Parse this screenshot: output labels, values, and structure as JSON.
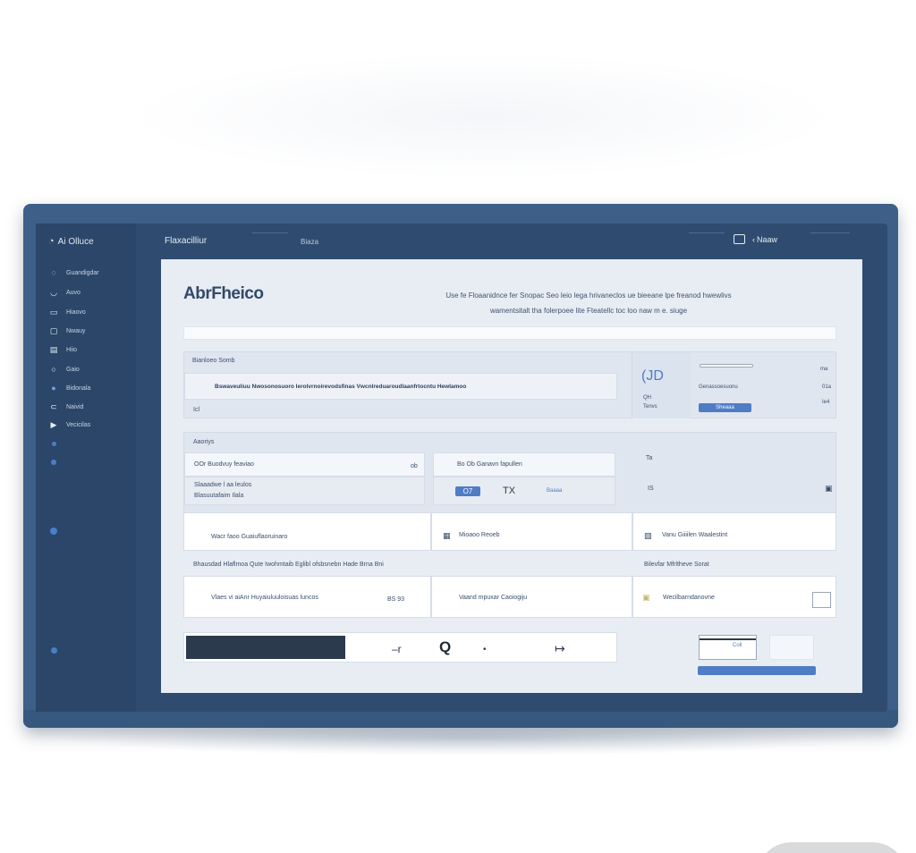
{
  "app": {
    "brand": "Ai Olluce",
    "header_title": "Flaxacilliur",
    "header_sub": "Biaza",
    "user_name": "Naaw"
  },
  "sidebar": {
    "items": [
      {
        "label": "Guandigdar",
        "icon": "swirl-icon"
      },
      {
        "label": "Auvo",
        "icon": "eye-icon"
      },
      {
        "label": "Hiaovo",
        "icon": "card-icon"
      },
      {
        "label": "Nwauy",
        "icon": "box-icon"
      },
      {
        "label": "Hiio",
        "icon": "chat-icon"
      },
      {
        "label": "Gaio",
        "icon": "circle-icon"
      },
      {
        "label": "Bidonala",
        "icon": "globe-icon"
      },
      {
        "label": "Naivid",
        "icon": "link-icon"
      },
      {
        "label": "Vecicilas",
        "icon": "play-icon"
      }
    ]
  },
  "main": {
    "title": "AbrFheico",
    "intro_line1": "Use fe Floaanidnce fer Snopac Seo leio lega hrivaneclos ue bieeane lpe freanod hwewlivs",
    "intro_line2": "wamentsitalt tha folerpoee lite Fteatellc toc loo naw m e. siuge",
    "panel1": {
      "label": "Bianloeo Somb",
      "input_text": "Bswaveuliuu Nwosonosuoro lerolvrnoirevodsfinas Vwcnlreduaroudlaanfrtocntu Hewlamoo",
      "footer": "Icl",
      "right": {
        "big_glyph": "(JD",
        "small_a": "QH",
        "small_b": "Tenvs",
        "mid_text": "Genassoesuonu",
        "btn": "Sheaaa",
        "num1": "ma",
        "num2": "01a",
        "num3": "Ie4"
      }
    },
    "panel2": {
      "label": "Aaoriys",
      "field1": "OOr Buodvuy feaviao",
      "field1_suffix": "ob",
      "field2_line1": "Slaaadwe l aa leulos",
      "field2_line2": "Blasuutafaim Ilala",
      "field3": "Bo Ob Ganavn fapullen",
      "tag": "O7",
      "symbol": "TX",
      "field3_end": "Baaaa",
      "col3_top": "Ta",
      "col3_num": "IS"
    },
    "cards_row1": [
      {
        "text": "Wacr faoo Guaiuflaoruinaro"
      },
      {
        "text": "Mioaoo Reoeb"
      },
      {
        "text": "Vanu Giiiilen Waalestint"
      }
    ],
    "row_label_left": "Bhausdad Hlaflmoa Qute Iwohmtaib Eglibl ofsbsnebn Hade Brna Bni",
    "row_label_right": "Bilevfar Mfrltheve Sorat",
    "cards_row2": [
      {
        "text": "Vlaes vi aiAnr Huyaiuluuloisuas luncos",
        "num": "BS 93"
      },
      {
        "text": "Vaand mpuxar Caoiogiju"
      },
      {
        "text": "Wecilbarndanovne"
      }
    ],
    "toolbar": {
      "glyph1": "–r",
      "glyph2": "Q",
      "glyph3": "↦"
    },
    "bottom_right": {
      "mini": "Coll",
      "btn": ""
    }
  },
  "colors": {
    "frame": "#3d5f88",
    "sidebar": "#2b4669",
    "accent": "#4f7cc4",
    "content_bg": "#e8edf4"
  }
}
